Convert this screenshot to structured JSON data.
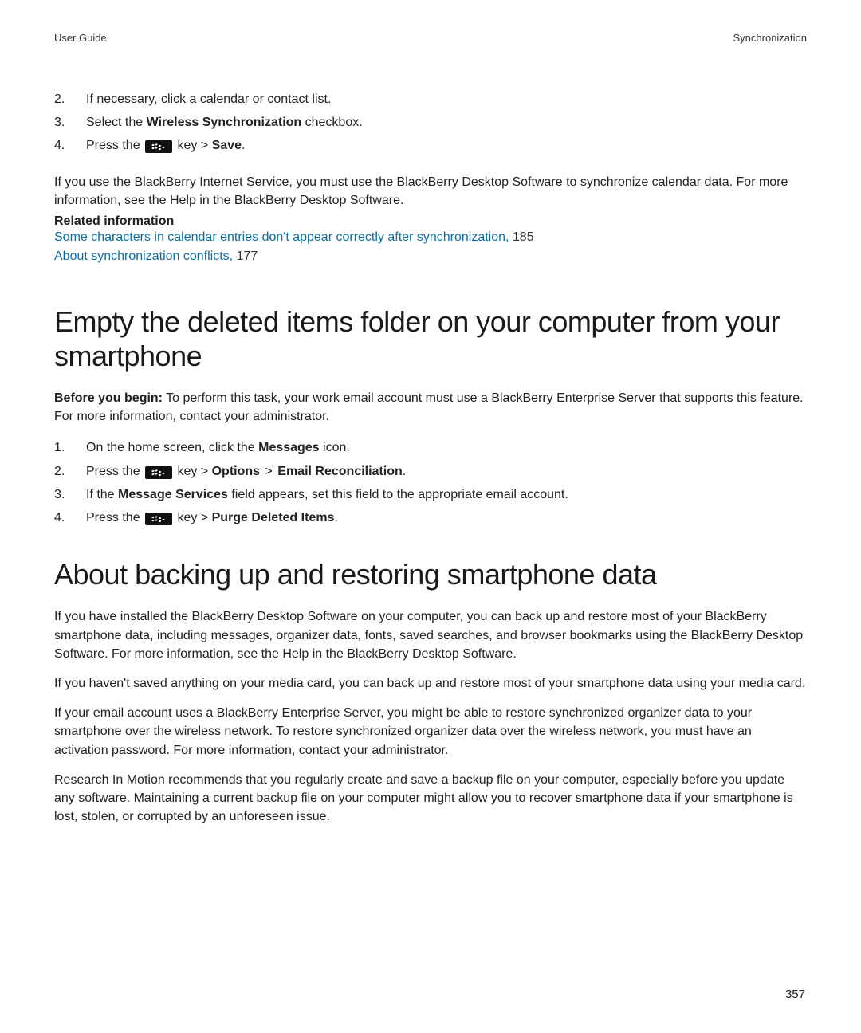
{
  "header": {
    "left": "User Guide",
    "right": "Synchronization"
  },
  "topSteps": [
    {
      "num": "2.",
      "pre": "If necessary, click a calendar or contact list."
    },
    {
      "num": "3.",
      "pre": "Select the ",
      "bold1": "Wireless Synchronization",
      "post1": " checkbox."
    },
    {
      "num": "4.",
      "pre": "Press the ",
      "key": true,
      "post1": " key > ",
      "bold1": "Save",
      "post2": "."
    }
  ],
  "paragraph1a": "If you use the BlackBerry Internet Service, you must use the BlackBerry Desktop Software to synchronize calendar data. For more information, see the Help in the BlackBerry Desktop Software.",
  "relatedHeading": "Related information",
  "relatedLinks": [
    {
      "text": "Some characters in calendar entries don't appear correctly after synchronization,",
      "page": "185"
    },
    {
      "text": "About synchronization conflicts,",
      "page": "177"
    }
  ],
  "section2": {
    "title": "Empty the deleted items folder on your computer from your smartphone",
    "before_label": "Before you begin:",
    "before_text": " To perform this task, your work email account must use a BlackBerry Enterprise Server that supports this feature. For more information, contact your administrator.",
    "steps": [
      {
        "num": "1.",
        "pre": "On the home screen, click the ",
        "bold1": "Messages",
        "post1": " icon."
      },
      {
        "num": "2.",
        "pre": "Press the ",
        "key": true,
        "post1": " key > ",
        "bold1": "Options",
        "post2": " > ",
        "bold2": "Email Reconciliation",
        "post3": "."
      },
      {
        "num": "3.",
        "pre": "If the ",
        "bold1": "Message Services",
        "post1": " field appears, set this field to the appropriate email account."
      },
      {
        "num": "4.",
        "pre": "Press the ",
        "key": true,
        "post1": " key > ",
        "bold1": "Purge Deleted Items",
        "post2": "."
      }
    ]
  },
  "section3": {
    "title": "About backing up and restoring smartphone data",
    "paras": [
      "If you have installed the BlackBerry Desktop Software on your computer, you can back up and restore most of your BlackBerry smartphone data, including messages, organizer data, fonts, saved searches, and browser bookmarks using the BlackBerry Desktop Software. For more information, see the Help in the BlackBerry Desktop Software.",
      "If you haven't saved anything on your media card, you can back up and restore most of your smartphone data using your media card.",
      "If your email account uses a BlackBerry Enterprise Server, you might be able to restore synchronized organizer data to your smartphone over the wireless network. To restore synchronized organizer data over the wireless network, you must have an activation password. For more information, contact your administrator.",
      "Research In Motion recommends that you regularly create and save a backup file on your computer, especially before you update any software. Maintaining a current backup file on your computer might allow you to recover smartphone data if your smartphone is lost, stolen, or corrupted by an unforeseen issue."
    ]
  },
  "pageNumber": "357"
}
